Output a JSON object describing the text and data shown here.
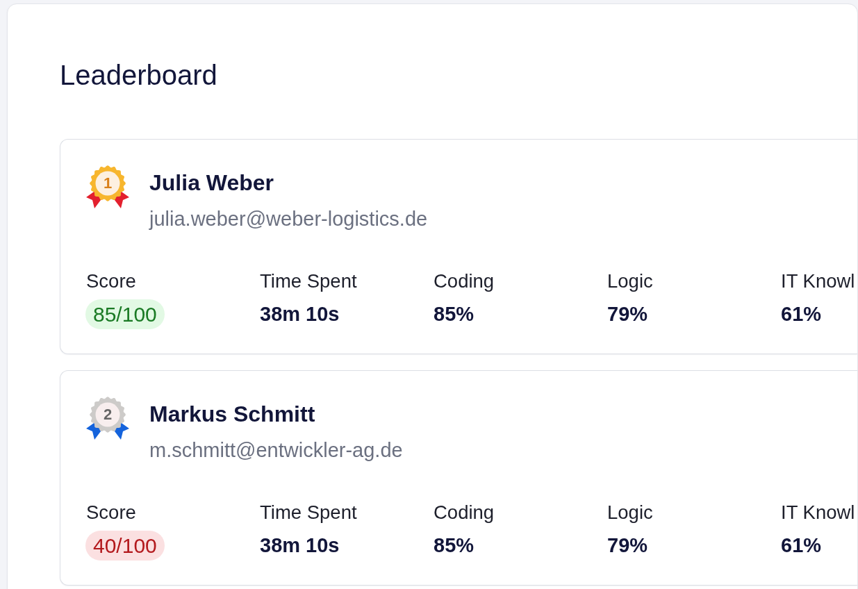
{
  "title": "Leaderboard",
  "entries": [
    {
      "kind": "gold",
      "rank": "1",
      "name": "Julia Weber",
      "email": "julia.weber@weber-logistics.de",
      "score": {
        "label": "Score",
        "value": "85/100",
        "color": "#1a7a24"
      },
      "metrics": [
        {
          "label": "Time Spent",
          "value": "38m 10s"
        },
        {
          "label": "Coding",
          "value": "85%"
        },
        {
          "label": "Logic",
          "value": "79%"
        },
        {
          "label": "IT Knowl",
          "value": "61%"
        }
      ]
    },
    {
      "kind": "silver",
      "rank": "2",
      "name": "Markus Schmitt",
      "email": "m.schmitt@entwickler-ag.de",
      "score": {
        "label": "Score",
        "value": "40/100",
        "color": "#b3191d"
      },
      "metrics": [
        {
          "label": "Time Spent",
          "value": "38m 10s"
        },
        {
          "label": "Coding",
          "value": "85%"
        },
        {
          "label": "Logic",
          "value": "79%"
        },
        {
          "label": "IT Knowl",
          "value": "61%"
        }
      ]
    }
  ]
}
